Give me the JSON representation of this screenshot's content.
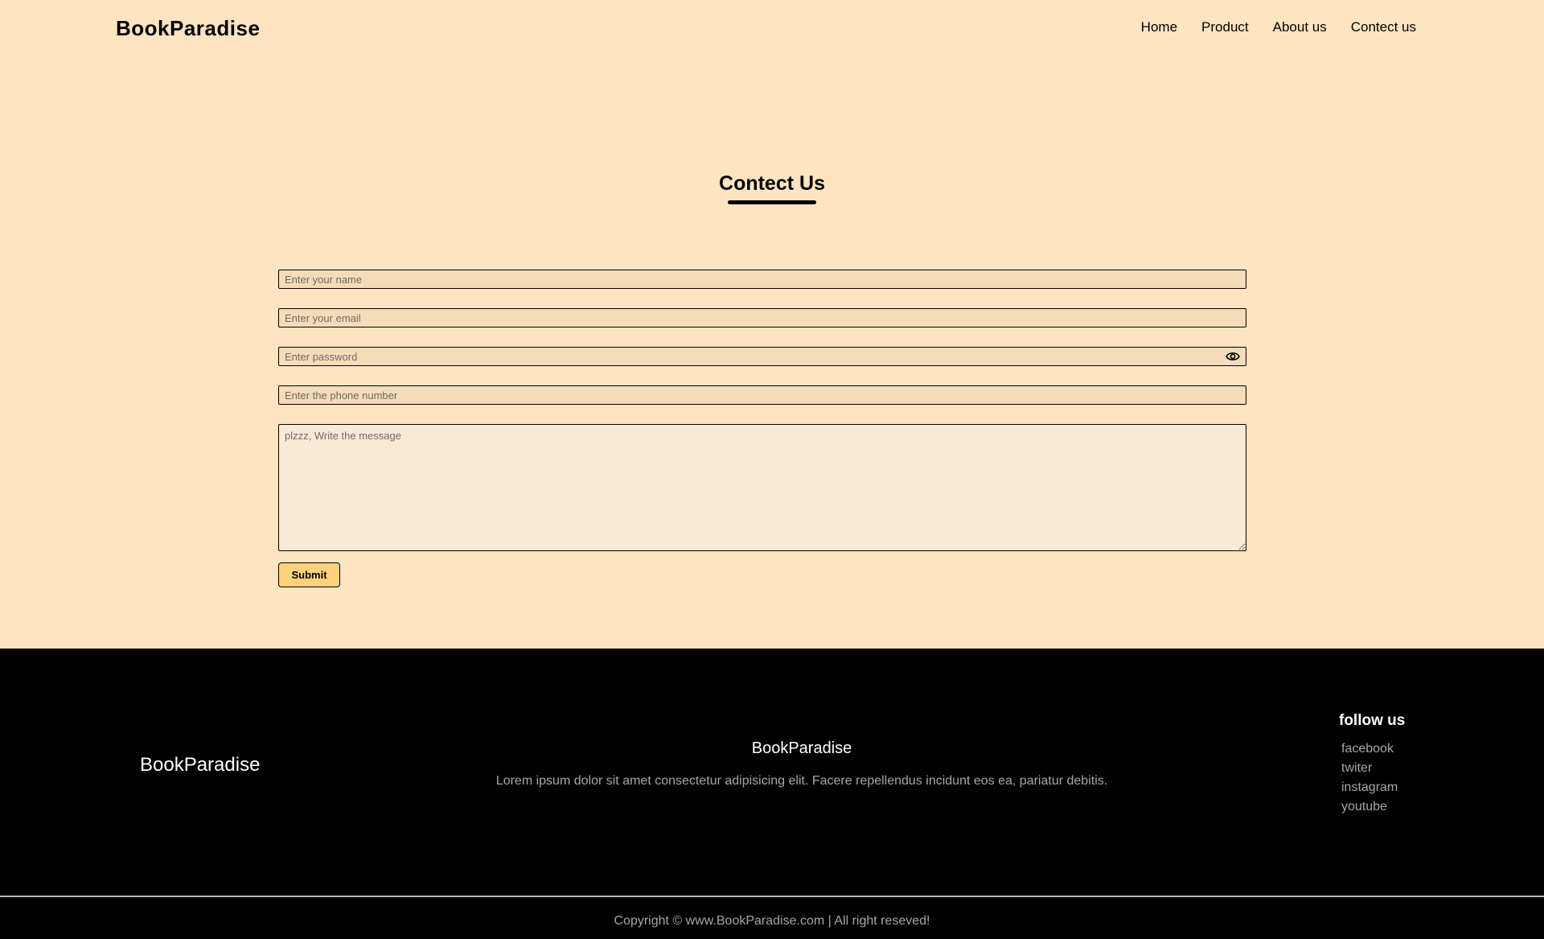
{
  "header": {
    "logo": "BookParadise",
    "nav": [
      "Home",
      "Product",
      "About us",
      "Contect us"
    ]
  },
  "contact": {
    "title": "Contect Us",
    "name_placeholder": "Enter your name",
    "email_placeholder": "Enter your email",
    "password_placeholder": "Enter password",
    "phone_placeholder": "Enter the phone number",
    "message_placeholder": "plzzz, Write the message",
    "submit_label": "Submit"
  },
  "footer": {
    "brand": "BookParadise",
    "center_title": "BookParadise",
    "center_text": "Lorem ipsum dolor sit amet consectetur adipisicing elit. Facere repellendus incidunt eos ea, pariatur debitis.",
    "follow_title": "follow us",
    "social": [
      "facebook",
      "twiter",
      "instagram",
      "youtube"
    ],
    "copyright": "Copyright © www.BookParadise.com | All right reseved!"
  },
  "colors": {
    "page_bg": "#ffe4c1",
    "submit_bg": "#fcd27e",
    "footer_bg": "#000000"
  },
  "icons": [
    "eye-icon"
  ]
}
